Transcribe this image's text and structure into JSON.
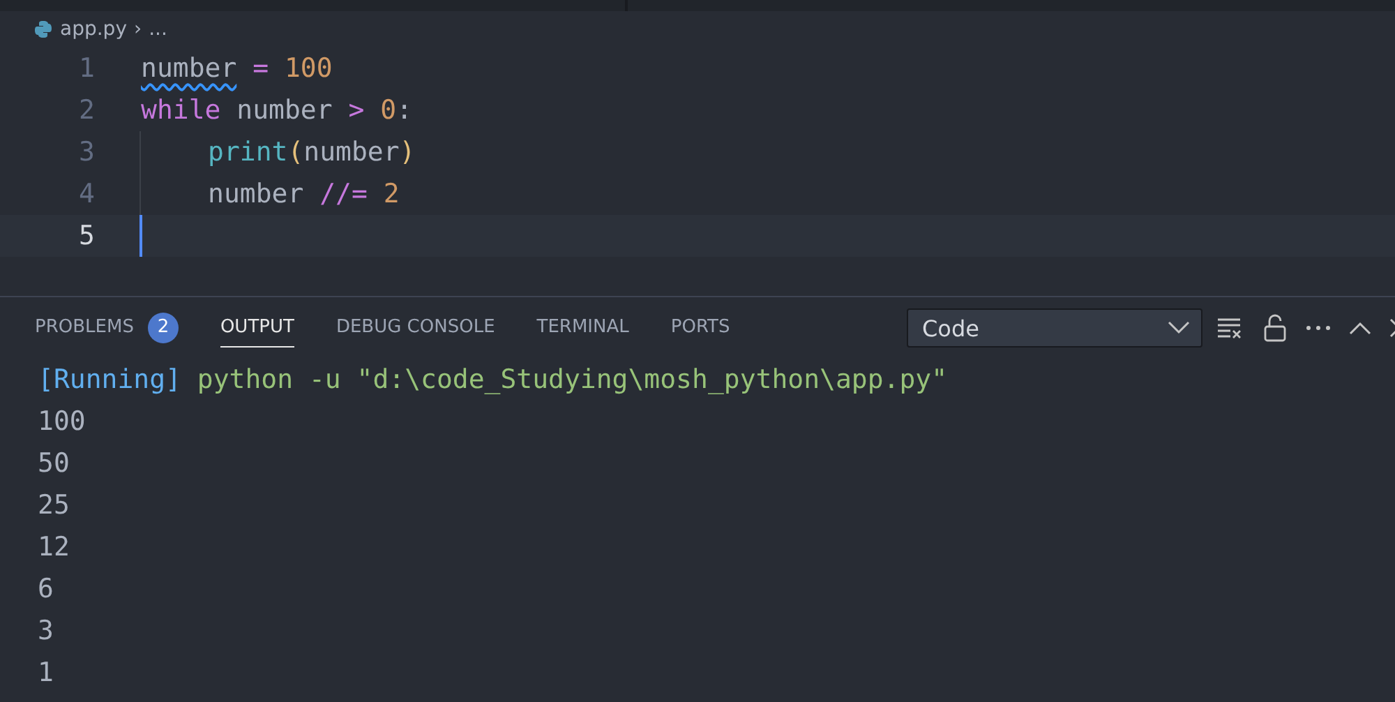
{
  "breadcrumb": {
    "file": "app.py",
    "separator": "›",
    "rest": "..."
  },
  "editor": {
    "lines": [
      {
        "number": "1",
        "current": false,
        "guide": false,
        "tokens": [
          {
            "text": "number",
            "kind": "variable",
            "squiggle": true
          },
          {
            "text": " = ",
            "kind": "operator",
            "squiggle": false
          },
          {
            "text": "100",
            "kind": "number",
            "squiggle": false
          }
        ]
      },
      {
        "number": "2",
        "current": false,
        "guide": false,
        "tokens": [
          {
            "text": "while",
            "kind": "keyword",
            "squiggle": false
          },
          {
            "text": " number ",
            "kind": "variable",
            "squiggle": false
          },
          {
            "text": ">",
            "kind": "operator",
            "squiggle": false
          },
          {
            "text": " 0",
            "kind": "number",
            "squiggle": false
          },
          {
            "text": ":",
            "kind": "plain",
            "squiggle": false
          }
        ]
      },
      {
        "number": "3",
        "current": false,
        "guide": true,
        "tokens": [
          {
            "text": "print",
            "kind": "function",
            "squiggle": false
          },
          {
            "text": "(",
            "kind": "bracket",
            "squiggle": false
          },
          {
            "text": "number",
            "kind": "variable",
            "squiggle": false
          },
          {
            "text": ")",
            "kind": "bracket",
            "squiggle": false
          }
        ]
      },
      {
        "number": "4",
        "current": false,
        "guide": true,
        "tokens": [
          {
            "text": "number ",
            "kind": "variable",
            "squiggle": false
          },
          {
            "text": "//=",
            "kind": "operator",
            "squiggle": false
          },
          {
            "text": " 2",
            "kind": "number",
            "squiggle": false
          }
        ]
      },
      {
        "number": "5",
        "current": true,
        "guide": false
      }
    ]
  },
  "panel": {
    "tabs": [
      {
        "label": "PROBLEMS",
        "selected": false,
        "badge": "2"
      },
      {
        "label": "OUTPUT",
        "selected": true
      },
      {
        "label": "DEBUG CONSOLE",
        "selected": false
      },
      {
        "label": "TERMINAL",
        "selected": false
      },
      {
        "label": "PORTS",
        "selected": false
      }
    ],
    "channel_select": {
      "value": "Code"
    },
    "output": [
      {
        "parts": [
          {
            "text": "[Running]",
            "kind": "status"
          },
          {
            "text": " python -u \"d:\\code_Studying\\mosh_python\\app.py\"",
            "kind": "command"
          }
        ]
      },
      {
        "parts": [
          {
            "text": "100",
            "kind": "plain"
          }
        ]
      },
      {
        "parts": [
          {
            "text": "50",
            "kind": "plain"
          }
        ]
      },
      {
        "parts": [
          {
            "text": "25",
            "kind": "plain"
          }
        ]
      },
      {
        "parts": [
          {
            "text": "12",
            "kind": "plain"
          }
        ]
      },
      {
        "parts": [
          {
            "text": "6",
            "kind": "plain"
          }
        ]
      },
      {
        "parts": [
          {
            "text": "3",
            "kind": "plain"
          }
        ]
      },
      {
        "parts": [
          {
            "text": "1",
            "kind": "plain"
          }
        ]
      }
    ]
  }
}
